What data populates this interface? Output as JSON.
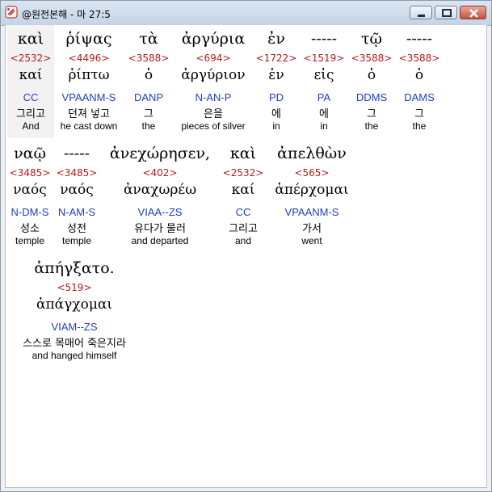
{
  "window": {
    "title": "@원전본해 - 마 27:5",
    "buttons": [
      "minimize",
      "maximize",
      "close"
    ]
  },
  "verse": [
    {
      "greek": "καὶ",
      "strongs": "<2532>",
      "lemma": "καί",
      "parsing": "CC",
      "korean": "그리고",
      "english": "And"
    },
    {
      "greek": "ῥίψας",
      "strongs": "<4496>",
      "lemma": "ῥίπτω",
      "parsing": "VPAANM-S",
      "korean": "던져 넣고",
      "english": "he cast down"
    },
    {
      "greek": "τὰ",
      "strongs": "<3588>",
      "lemma": "ὁ",
      "parsing": "DANP",
      "korean": "그",
      "english": "the"
    },
    {
      "greek": "ἀργύρια",
      "strongs": "<694>",
      "lemma": "ἀργύριον",
      "parsing": "N-AN-P",
      "korean": "은을",
      "english": "pieces of silver"
    },
    {
      "greek": "ἐν",
      "strongs": "<1722>",
      "lemma": "ἐν",
      "parsing": "PD",
      "korean": "에",
      "english": "in"
    },
    {
      "greek": "-----",
      "strongs": "<1519>",
      "lemma": "εἰς",
      "parsing": "PA",
      "korean": "에",
      "english": "in"
    },
    {
      "greek": "τῷ",
      "strongs": "<3588>",
      "lemma": "ὁ",
      "parsing": "DDMS",
      "korean": "그",
      "english": "the"
    },
    {
      "greek": "-----",
      "strongs": "<3588>",
      "lemma": "ὁ",
      "parsing": "DAMS",
      "korean": "그",
      "english": "the"
    },
    {
      "greek": "ναῷ",
      "strongs": "<3485>",
      "lemma": "ναός",
      "parsing": "N-DM-S",
      "korean": "성소",
      "english": "temple"
    },
    {
      "greek": "-----",
      "strongs": "<3485>",
      "lemma": "ναός",
      "parsing": "N-AM-S",
      "korean": "성전",
      "english": "temple"
    },
    {
      "greek": "ἀνεχώρησεν,",
      "strongs": "<402>",
      "lemma": "ἀναχωρέω",
      "parsing": "VIAA--ZS",
      "korean": "유다가 물러",
      "english": "and departed"
    },
    {
      "greek": "καὶ",
      "strongs": "<2532>",
      "lemma": "καί",
      "parsing": "CC",
      "korean": "그리고",
      "english": "and"
    },
    {
      "greek": "ἀπελθὼν",
      "strongs": "<565>",
      "lemma": "ἀπέρχομαι",
      "parsing": "VPAANM-S",
      "korean": "가서",
      "english": "went"
    },
    {
      "greek": "ἀπήγξατο.",
      "strongs": "<519>",
      "lemma": "ἀπάγχομαι",
      "parsing": "VIAM--ZS",
      "korean": "스스로 목매어 죽은지라",
      "english": "and hanged himself"
    }
  ]
}
